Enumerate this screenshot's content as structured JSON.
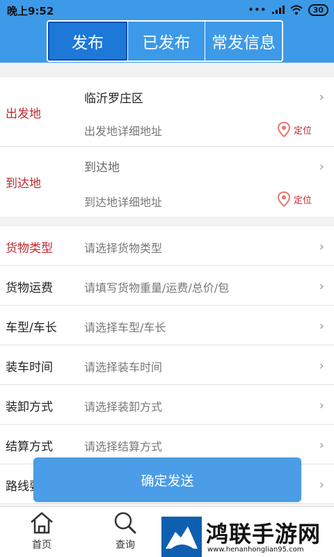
{
  "status_bar": {
    "time": "晚上9:52",
    "battery": "30"
  },
  "tabs": [
    {
      "label": "发布",
      "active": true
    },
    {
      "label": "已发布",
      "active": false
    },
    {
      "label": "常发信息",
      "active": false
    }
  ],
  "origin": {
    "label": "出发地",
    "city": "临沂罗庄区",
    "detail_placeholder": "出发地详细地址",
    "locate_label": "定位"
  },
  "destination": {
    "label": "到达地",
    "city_placeholder": "到达地",
    "detail_placeholder": "到达地详细地址",
    "locate_label": "定位"
  },
  "form_rows": [
    {
      "label": "货物类型",
      "placeholder": "请选择货物类型",
      "required": true
    },
    {
      "label": "货物运费",
      "placeholder": "请填写货物重量/运费/总价/包",
      "required": false
    },
    {
      "label": "车型/车长",
      "placeholder": "请选择车型/车长",
      "required": false
    },
    {
      "label": "装车时间",
      "placeholder": "请选择装车时间",
      "required": false
    },
    {
      "label": "装卸方式",
      "placeholder": "请选择装卸方式",
      "required": false
    },
    {
      "label": "结算方式",
      "placeholder": "请选择结算方式",
      "required": false
    },
    {
      "label": "路线要",
      "placeholder": "",
      "required": false
    }
  ],
  "confirm_label": "确定发送",
  "bottom_nav": [
    {
      "label": "首页",
      "icon": "home-icon"
    },
    {
      "label": "查询",
      "icon": "search-icon"
    }
  ],
  "watermark": {
    "text": "鸿联手游网",
    "url": "www.henanhonglian95.com"
  },
  "colors": {
    "header": "#3d9ae8",
    "active_tab": "#1e78d8",
    "required_label": "#c0282d",
    "confirm_button": "#4a9de6"
  }
}
